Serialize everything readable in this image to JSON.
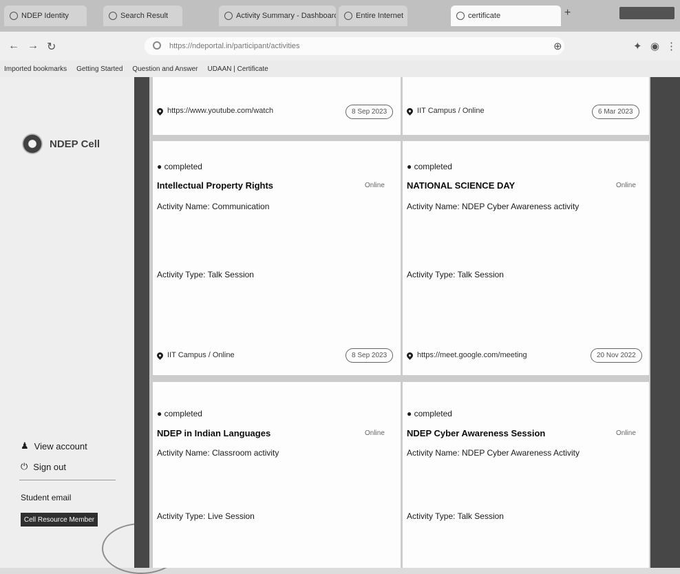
{
  "browser": {
    "tabs": [
      {
        "label": "NDEP Identity"
      },
      {
        "label": "Search Result"
      },
      {
        "label": "Activity Summary - Dashboard"
      },
      {
        "label": "Entire Internet"
      },
      {
        "label": "certificate"
      }
    ],
    "address": "https://ndeportal.in/participant/activities",
    "bookmarks": [
      "Imported bookmarks",
      "Getting Started",
      "Question and Answer",
      "UDAAN | Certificate"
    ]
  },
  "sidebar": {
    "logo_text": "NDEP Cell",
    "view_account": "View account",
    "sign_out": "Sign out",
    "email": "Student email",
    "button": "Cell Resource Member"
  },
  "cards": [
    {
      "location": "https://www.youtube.com/watch",
      "date": "8 Sep 2023"
    },
    {
      "location": "IIT Campus / Online",
      "date": "6 Mar 2023"
    },
    {
      "status": "completed",
      "title": "Intellectual Property Rights",
      "mode": "Online",
      "activity_name": "Activity Name: Communication",
      "activity_type": "Activity Type: Talk Session",
      "location": "IIT Campus / Online",
      "date": "8 Sep 2023"
    },
    {
      "status": "completed",
      "title": "NATIONAL SCIENCE DAY",
      "mode": "Online",
      "activity_name": "Activity Name: NDEP Cyber Awareness activity",
      "activity_type": "Activity Type: Talk Session",
      "location": "https://meet.google.com/meeting",
      "date": "20 Nov 2022"
    },
    {
      "status": "completed",
      "title": "NDEP in Indian Languages",
      "mode": "Online",
      "activity_name": "Activity Name: Classroom activity",
      "activity_type": "Activity Type: Live Session"
    },
    {
      "status": "completed",
      "title": "NDEP Cyber Awareness Session",
      "mode": "Online",
      "activity_name": "Activity Name: NDEP Cyber Awareness Activity",
      "activity_type": "Activity Type: Talk Session"
    }
  ]
}
